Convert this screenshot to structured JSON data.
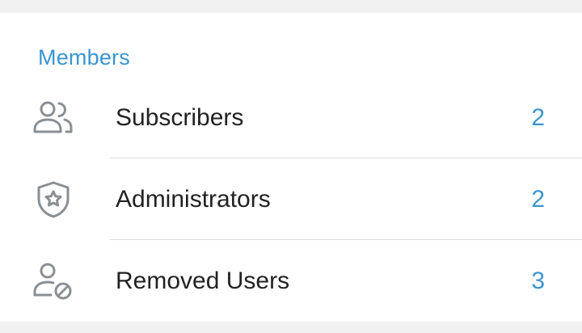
{
  "section": {
    "title": "Members"
  },
  "items": [
    {
      "label": "Subscribers",
      "count": "2",
      "icon": "users-icon"
    },
    {
      "label": "Administrators",
      "count": "2",
      "icon": "shield-star-icon"
    },
    {
      "label": "Removed Users",
      "count": "3",
      "icon": "user-blocked-icon"
    }
  ],
  "colors": {
    "accent": "#3a95cf",
    "text": "#222222",
    "icon": "#8a8f94",
    "divider": "#dcdcdc",
    "background": "#f0f0f0",
    "card": "#ffffff"
  }
}
